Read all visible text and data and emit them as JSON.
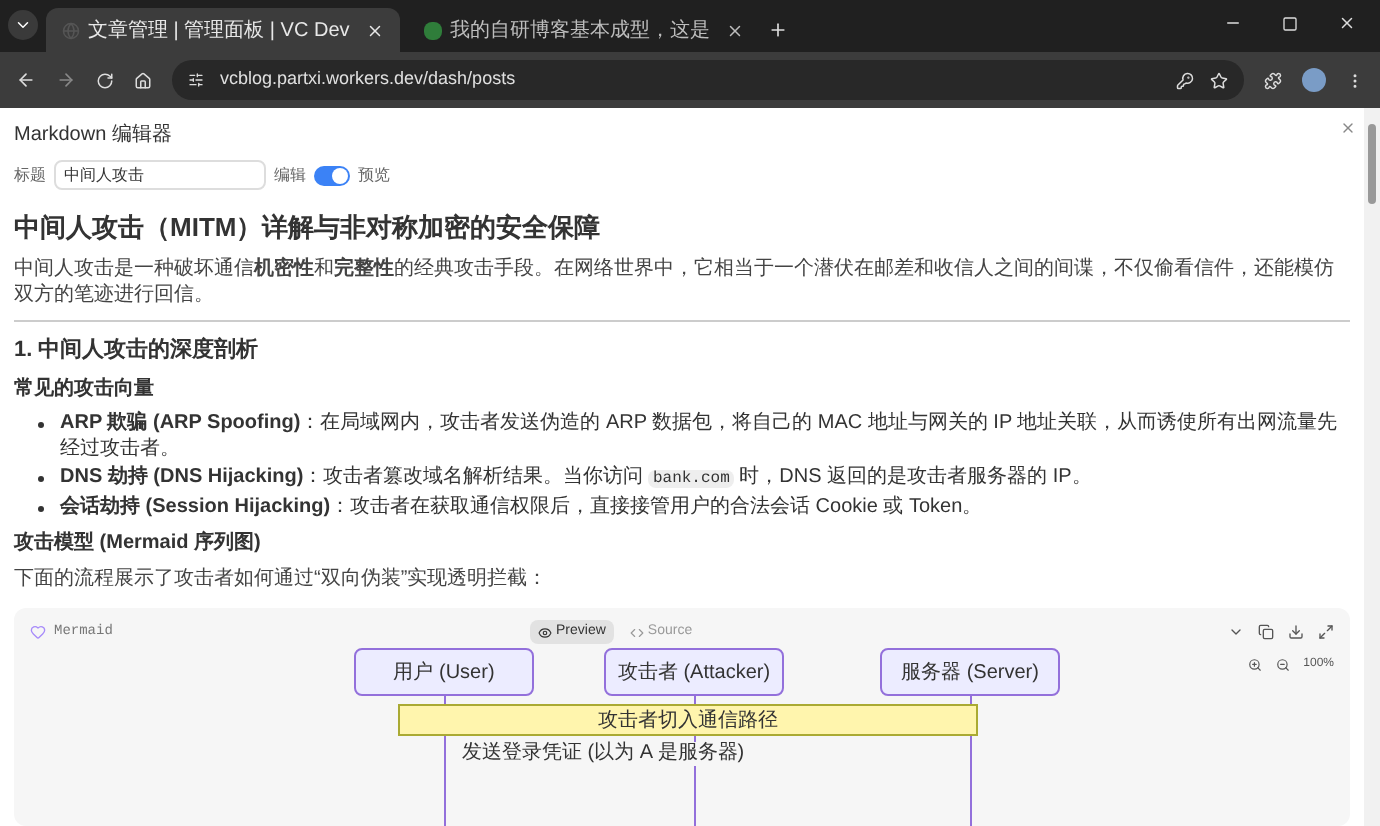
{
  "browser": {
    "tabs": [
      {
        "title": "文章管理 | 管理面板 | VC Dev",
        "selected": true,
        "kind": "globe"
      },
      {
        "title": "我的自研博客基本成型，这是",
        "selected": false,
        "kind": "nl"
      }
    ],
    "url": "vcblog.partxi.workers.dev/dash/posts"
  },
  "editor": {
    "title": "Markdown 编辑器",
    "title_label": "标题",
    "title_value": "中间人攻击",
    "edit_label": "编辑",
    "preview_on": true,
    "preview_label": "预览"
  },
  "article": [
    {
      "kind": "h1",
      "text": "中间人攻击（MITM）详解与非对称加密的安全保障"
    },
    {
      "kind": "p",
      "text": "中间人攻击是一种破坏通信**机密性**和**完整性**的经典攻击手段。在网络世界中，它相当于一个潜伏在邮差和收信人之间的间谍，不仅偷看信件，还能模仿双方的笔迹进行回信。"
    },
    {
      "kind": "hr"
    },
    {
      "kind": "h2",
      "text": "1. 中间人攻击的深度剖析"
    },
    {
      "kind": "h4",
      "text": "常见的攻击向量"
    },
    {
      "kind": "ul",
      "items": [
        {
          "parts": [
            {
              "kind": "bold",
              "text": "ARP 欺骗 (ARP Spoofing)"
            },
            {
              "kind": "text",
              "text": "：在局域网内，攻击者发送伪造的 ARP 数据包，将自己的 MAC 地址与网关的 IP 地址关联，从而诱使所有出网流量先经过攻击者。"
            }
          ]
        },
        {
          "parts": [
            {
              "kind": "bold",
              "text": "DNS 劫持 (DNS Hijacking)"
            },
            {
              "kind": "text",
              "text": "：攻击者篡改域名解析结果。当你访问 "
            },
            {
              "kind": "code",
              "text": "bank.com"
            },
            {
              "kind": "text",
              "text": " 时，DNS 返回的是攻击者服务器的 IP。"
            }
          ]
        },
        {
          "parts": [
            {
              "kind": "bold",
              "text": "会话劫持 (Session Hijacking)"
            },
            {
              "kind": "text",
              "text": "：攻击者在获取通信权限后，直接接管用户的合法会话 Cookie 或 Token。"
            }
          ]
        }
      ]
    },
    {
      "kind": "h4",
      "text": "攻击模型 (Mermaid 序列图)"
    },
    {
      "kind": "p",
      "text": "下面的流程展示了攻击者如何通过“双向伪装”实现透明拦截："
    },
    {
      "kind": "mermaid",
      "label": "Mermaid",
      "tabs": [
        {
          "label": "Preview",
          "selected": true
        },
        {
          "label": "Source",
          "selected": false
        }
      ],
      "zoom": "100%",
      "actors": [
        "用户 (User)",
        "攻击者 (Attacker)",
        "服务器 (Server)"
      ],
      "note": "攻击者切入通信路径",
      "message": "发送登录凭证 (以为 A 是服务器)"
    }
  ]
}
